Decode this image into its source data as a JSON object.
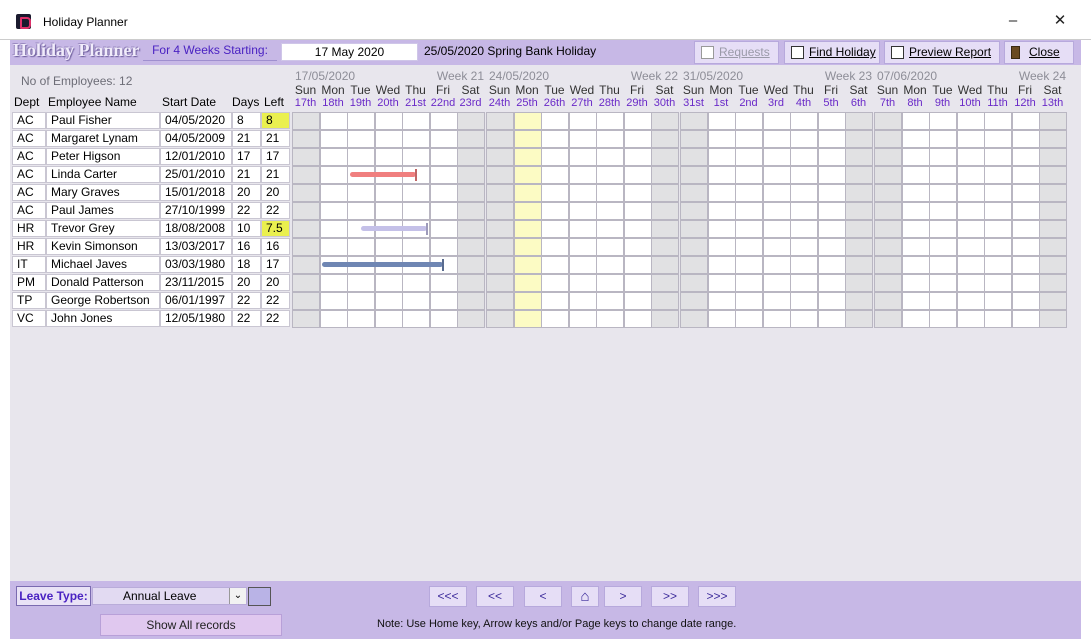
{
  "window": {
    "title": "Holiday Planner",
    "min": "–",
    "close": "✕"
  },
  "toolbar": {
    "brand": "Holiday Planner",
    "weeks_label": "For 4 Weeks Starting:",
    "start_date": "17 May 2020",
    "holiday_info": "25/05/2020  Spring Bank Holiday",
    "requests": "Requests",
    "find_holiday": "Find Holiday",
    "preview_report": "Preview Report",
    "close": "Close"
  },
  "summary": {
    "no_employees": "No of Employees:  12"
  },
  "columns": {
    "dept": "Dept",
    "name": "Employee Name",
    "start": "Start Date",
    "days": "Days",
    "left": "Left"
  },
  "weeks": [
    {
      "date": "17/05/2020",
      "label": "Week 21"
    },
    {
      "date": "24/05/2020",
      "label": "Week 22"
    },
    {
      "date": "31/05/2020",
      "label": "Week 23"
    },
    {
      "date": "07/06/2020",
      "label": "Week 24"
    }
  ],
  "day_names": [
    "Sun",
    "Mon",
    "Tue",
    "Wed",
    "Thu",
    "Fri",
    "Sat"
  ],
  "day_nums": [
    "17th",
    "18th",
    "19th",
    "20th",
    "21st",
    "22nd",
    "23rd",
    "24th",
    "25th",
    "26th",
    "27th",
    "28th",
    "29th",
    "30th",
    "31st",
    "1st",
    "2nd",
    "3rd",
    "4th",
    "5th",
    "6th",
    "7th",
    "8th",
    "9th",
    "10th",
    "11th",
    "12th",
    "13th"
  ],
  "bank_holiday_index": 8,
  "employees": [
    {
      "dept": "AC",
      "name": "Paul Fisher",
      "start": "04/05/2020",
      "days": "8",
      "left": "8",
      "highlight": true
    },
    {
      "dept": "AC",
      "name": "Margaret Lynam",
      "start": "04/05/2009",
      "days": "21",
      "left": "21"
    },
    {
      "dept": "AC",
      "name": "Peter Higson",
      "start": "12/01/2010",
      "days": "17",
      "left": "17"
    },
    {
      "dept": "AC",
      "name": "Linda Carter",
      "start": "25/01/2010",
      "days": "21",
      "left": "21"
    },
    {
      "dept": "AC",
      "name": "Mary Graves",
      "start": "15/01/2018",
      "days": "20",
      "left": "20"
    },
    {
      "dept": "AC",
      "name": "Paul James",
      "start": "27/10/1999",
      "days": "22",
      "left": "22"
    },
    {
      "dept": "HR",
      "name": "Trevor Grey",
      "start": "18/08/2008",
      "days": "10",
      "left": "7.5",
      "highlight": true
    },
    {
      "dept": "HR",
      "name": "Kevin Simonson",
      "start": "13/03/2017",
      "days": "16",
      "left": "16"
    },
    {
      "dept": "IT",
      "name": "Michael Javes",
      "start": "03/03/1980",
      "days": "18",
      "left": "17"
    },
    {
      "dept": "PM",
      "name": "Donald Patterson",
      "start": "23/11/2015",
      "days": "20",
      "left": "20"
    },
    {
      "dept": "TP",
      "name": "George Robertson",
      "start": "06/01/1997",
      "days": "22",
      "left": "22"
    },
    {
      "dept": "VC",
      "name": "John Jones",
      "start": "12/05/1980",
      "days": "22",
      "left": "22"
    }
  ],
  "bookings": [
    {
      "row": 3,
      "from": 2.1,
      "to": 4.5,
      "color": "#f07f7f"
    },
    {
      "row": 6,
      "from": 2.5,
      "to": 4.9,
      "color": "#c4c0e8"
    },
    {
      "row": 8,
      "from": 1.1,
      "to": 5.5,
      "color": "#6f86b3"
    }
  ],
  "footer": {
    "leave_type_label": "Leave Type:",
    "leave_type_value": "Annual Leave",
    "leave_color": "#b9b3e6",
    "nav": [
      "<<<",
      "<<",
      "<",
      "⌂",
      ">",
      ">>",
      ">>>"
    ],
    "show_all": "Show All records",
    "note": "Note: Use Home key, Arrow keys and/or Page keys to change date range."
  }
}
